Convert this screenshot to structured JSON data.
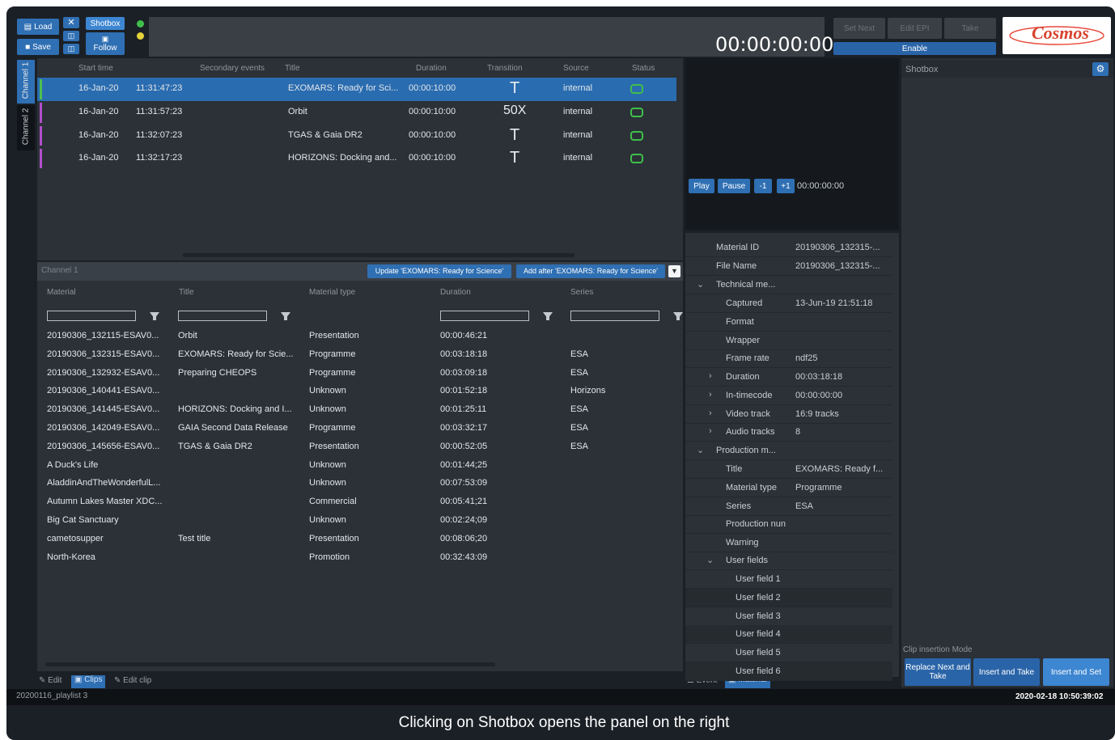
{
  "toolbar": {
    "load_label": "Load",
    "save_label": "Save",
    "shotbox_label": "Shotbox",
    "follow_label": "Follow",
    "timecode": "00:00:00:00",
    "dim_buttons": [
      "Set Next",
      "Edit EPI",
      "Take"
    ],
    "enable_label": "Enable",
    "logo_text": "Cosmos"
  },
  "channels": [
    "Channel 1",
    "Channel 2"
  ],
  "playlist": {
    "headers": [
      "Start time",
      "Secondary events",
      "Title",
      "Duration",
      "Transition",
      "Source",
      "Status"
    ],
    "rows": [
      {
        "date": "16-Jan-20",
        "time": "11:31:47:23",
        "title": "EXOMARS: Ready for Sci...",
        "duration": "00:00:10:00",
        "transition": "T",
        "source": "internal"
      },
      {
        "date": "16-Jan-20",
        "time": "11:31:57:23",
        "title": "Orbit",
        "duration": "00:00:10:00",
        "transition": "50X",
        "source": "internal"
      },
      {
        "date": "16-Jan-20",
        "time": "11:32:07:23",
        "title": "TGAS & Gaia DR2",
        "duration": "00:00:10:00",
        "transition": "T",
        "source": "internal"
      },
      {
        "date": "16-Jan-20",
        "time": "11:32:17:23",
        "title": "HORIZONS: Docking and...",
        "duration": "00:00:10:00",
        "transition": "T",
        "source": "internal"
      }
    ]
  },
  "player": {
    "play": "Play",
    "pause": "Pause",
    "minus": "-1",
    "plus": "+1",
    "timecode": "00:00:00:00"
  },
  "materials_bar": {
    "channel_label": "Channel 1",
    "update_label": "Update 'EXOMARS: Ready for Science'",
    "add_after_label": "Add after 'EXOMARS: Ready for Science'"
  },
  "materials": {
    "headers": [
      "Material",
      "Title",
      "Material type",
      "Duration",
      "Series"
    ],
    "rows": [
      {
        "material": "20190306_132115-ESAV0...",
        "title": "Orbit",
        "type": "Presentation",
        "duration": "00:00:46:21",
        "series": ""
      },
      {
        "material": "20190306_132315-ESAV0...",
        "title": "EXOMARS: Ready for Scie...",
        "type": "Programme",
        "duration": "00:03:18:18",
        "series": "ESA"
      },
      {
        "material": "20190306_132932-ESAV0...",
        "title": "Preparing CHEOPS",
        "type": "Programme",
        "duration": "00:03:09:18",
        "series": "ESA"
      },
      {
        "material": "20190306_140441-ESAV0...",
        "title": "",
        "type": "Unknown",
        "duration": "00:01:52:18",
        "series": "Horizons"
      },
      {
        "material": "20190306_141445-ESAV0...",
        "title": "HORIZONS: Docking and I...",
        "type": "Unknown",
        "duration": "00:01:25:11",
        "series": "ESA"
      },
      {
        "material": "20190306_142049-ESAV0...",
        "title": "GAIA Second Data Release",
        "type": "Programme",
        "duration": "00:03:32:17",
        "series": "ESA"
      },
      {
        "material": "20190306_145656-ESAV0...",
        "title": "TGAS & Gaia DR2",
        "type": "Presentation",
        "duration": "00:00:52:05",
        "series": "ESA"
      },
      {
        "material": "A Duck's Life",
        "title": "",
        "type": "Unknown",
        "duration": "00:01:44;25",
        "series": ""
      },
      {
        "material": "AladdinAndTheWonderfulL...",
        "title": "",
        "type": "Unknown",
        "duration": "00:07:53:09",
        "series": ""
      },
      {
        "material": "Autumn Lakes Master XDC...",
        "title": "",
        "type": "Commercial",
        "duration": "00:05:41;21",
        "series": ""
      },
      {
        "material": "Big Cat Sanctuary",
        "title": "",
        "type": "Unknown",
        "duration": "00:02:24;09",
        "series": ""
      },
      {
        "material": "cametosupper",
        "title": "Test title",
        "type": "Presentation",
        "duration": "00:08:06;20",
        "series": ""
      },
      {
        "material": "North-Korea",
        "title": "",
        "type": "Promotion",
        "duration": "00:32:43:09",
        "series": ""
      }
    ]
  },
  "bottom_tabs_left": [
    "Edit",
    "Clips",
    "Edit clip"
  ],
  "bottom_tabs_mid": [
    "Event",
    "Material"
  ],
  "properties": [
    {
      "key": "Material ID",
      "value": "20190306_132315-...",
      "level": 0,
      "chevron": ""
    },
    {
      "key": "File Name",
      "value": "20190306_132315-...",
      "level": 0,
      "chevron": ""
    },
    {
      "key": "Technical me...",
      "value": "",
      "level": 0,
      "chevron": "v"
    },
    {
      "key": "Captured",
      "value": "13-Jun-19 21:51:18",
      "level": 1,
      "chevron": ""
    },
    {
      "key": "Format",
      "value": "",
      "level": 1,
      "chevron": ""
    },
    {
      "key": "Wrapper",
      "value": "",
      "level": 1,
      "chevron": ""
    },
    {
      "key": "Frame rate",
      "value": "ndf25",
      "level": 1,
      "chevron": ""
    },
    {
      "key": "Duration",
      "value": "00:03:18:18",
      "level": 1,
      "chevron": ">"
    },
    {
      "key": "In-timecode",
      "value": "00:00:00:00",
      "level": 1,
      "chevron": ">"
    },
    {
      "key": "Video track",
      "value": "16:9 tracks",
      "level": 1,
      "chevron": ">"
    },
    {
      "key": "Audio tracks",
      "value": "8",
      "level": 1,
      "chevron": ">"
    },
    {
      "key": "Production m...",
      "value": "",
      "level": 0,
      "chevron": "v"
    },
    {
      "key": "Title",
      "value": "EXOMARS: Ready f...",
      "level": 1,
      "chevron": ""
    },
    {
      "key": "Material type",
      "value": "Programme",
      "level": 1,
      "chevron": ""
    },
    {
      "key": "Series",
      "value": "ESA",
      "level": 1,
      "chevron": ""
    },
    {
      "key": "Production nun",
      "value": "",
      "level": 1,
      "chevron": ""
    },
    {
      "key": "Warning",
      "value": "",
      "level": 1,
      "chevron": ""
    },
    {
      "key": "User fields",
      "value": "",
      "level": 1,
      "chevron": "v"
    },
    {
      "key": "User field 1",
      "value": "",
      "level": 2,
      "chevron": ""
    },
    {
      "key": "User field 2",
      "value": "",
      "level": 2,
      "chevron": ""
    },
    {
      "key": "User field 3",
      "value": "",
      "level": 2,
      "chevron": ""
    },
    {
      "key": "User field 4",
      "value": "",
      "level": 2,
      "chevron": ""
    },
    {
      "key": "User field 5",
      "value": "",
      "level": 2,
      "chevron": ""
    },
    {
      "key": "User field 6",
      "value": "",
      "level": 2,
      "chevron": ""
    }
  ],
  "shotbox": {
    "title": "Shotbox",
    "clip_insertion_label": "Clip insertion Mode",
    "replace_next": "Replace Next and Take",
    "insert_take": "Insert and Take",
    "insert_set": "Insert and Set"
  },
  "status": {
    "playlist_name": "20200116_playlist 3",
    "datetime": "2020-02-18 10:50:39:02"
  },
  "caption": "Clicking on Shotbox opens the panel on the right",
  "colors": {
    "accent": "#2f6fb3",
    "selected_row": "#2a6cb0",
    "status_green": "#3fbf4a",
    "status_yellow": "#e5d23a"
  }
}
